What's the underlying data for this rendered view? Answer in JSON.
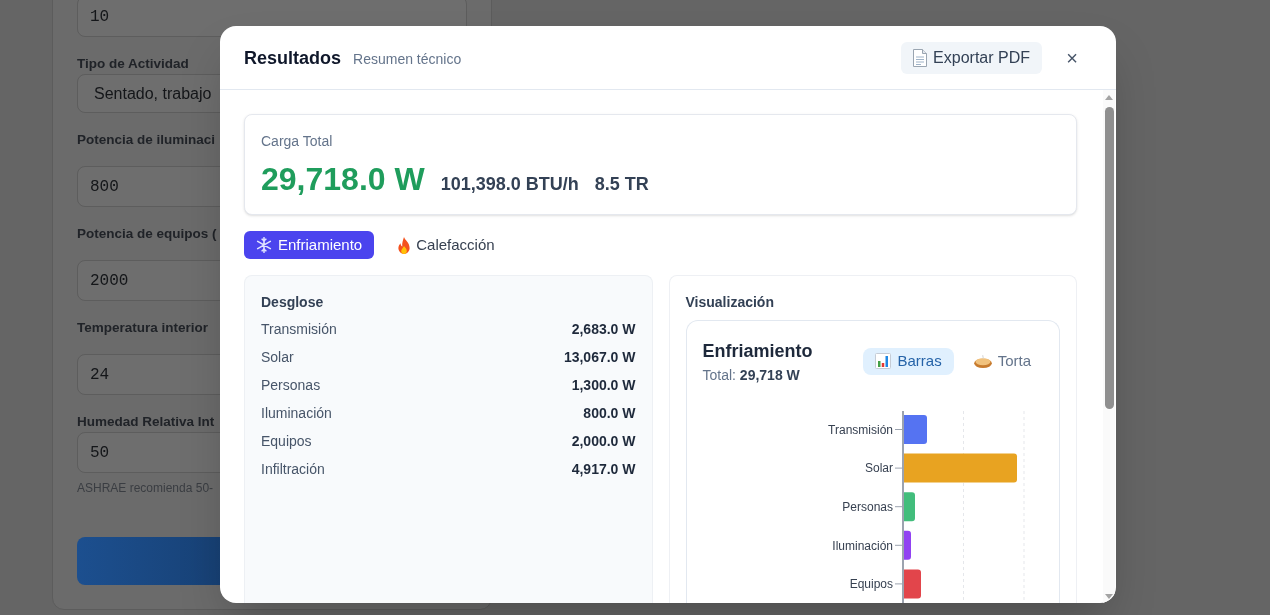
{
  "background_form": {
    "fields": [
      {
        "kind": "number",
        "value": "10"
      },
      {
        "kind": "select",
        "label": "Tipo de Actividad",
        "value": "Sentado, trabajo"
      },
      {
        "kind": "number",
        "label": "Potencia de iluminaci",
        "value": "800"
      },
      {
        "kind": "number",
        "label": "Potencia de equipos (",
        "value": "2000"
      },
      {
        "kind": "number",
        "label": "Temperatura interior",
        "value": "24"
      },
      {
        "kind": "number",
        "label": "Humedad Relativa Int",
        "value": "50",
        "hint": "ASHRAE recomienda 50-"
      }
    ]
  },
  "modal": {
    "title": "Resultados",
    "subtitle": "Resumen técnico",
    "export_button": "Exportar PDF",
    "close_button": "×"
  },
  "summary": {
    "label": "Carga Total",
    "power": "29,718.0 W",
    "btu": "101,398.0 BTU/h",
    "tons": "8.5 TR"
  },
  "mode_tabs": [
    {
      "kind": "cooling",
      "label": "Enfriamiento",
      "selected": true
    },
    {
      "kind": "heating",
      "label": "Calefacción",
      "selected": false
    }
  ],
  "breakdown": {
    "title": "Desglose",
    "rows": [
      {
        "label": "Transmisión",
        "value": "2,683.0 W"
      },
      {
        "label": "Solar",
        "value": "13,067.0 W"
      },
      {
        "label": "Personas",
        "value": "1,300.0 W"
      },
      {
        "label": "Iluminación",
        "value": "800.0 W"
      },
      {
        "label": "Equipos",
        "value": "2,000.0 W"
      },
      {
        "label": "Infiltración",
        "value": "4,917.0 W"
      }
    ]
  },
  "visualization": {
    "title": "Visualización",
    "chart_title": "Enfriamiento",
    "total": "Total: **29,718 W**",
    "view_buttons": [
      {
        "kind": "bars",
        "label": "Barras",
        "selected": true
      },
      {
        "kind": "pie",
        "label": "Torta",
        "selected": false
      }
    ],
    "chart": {
      "bars": [
        {
          "label": "Transmisión",
          "color": "#5573f2"
        },
        {
          "label": "Solar",
          "color": "#e8a321"
        },
        {
          "label": "Personas",
          "color": "#42bd7c"
        },
        {
          "label": "Iluminación",
          "color": "#9142f2"
        },
        {
          "label": "Equipos",
          "color": "#e2454b"
        }
      ]
    }
  }
}
